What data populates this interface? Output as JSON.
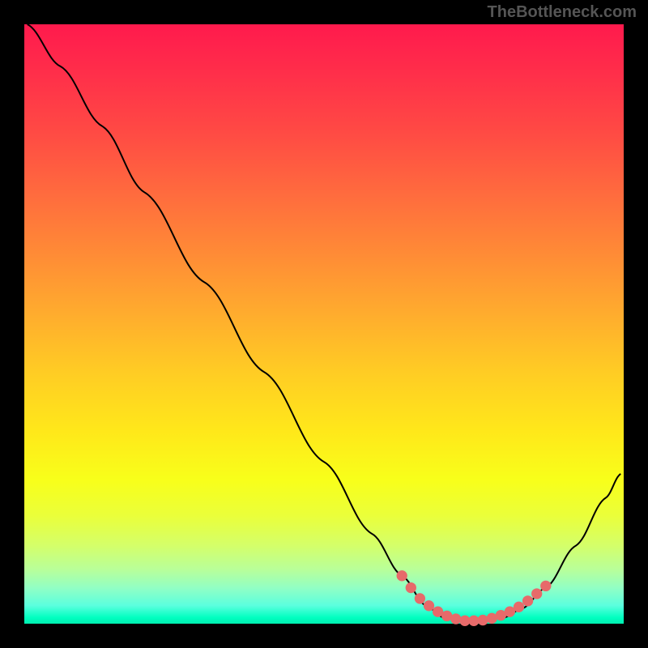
{
  "watermark": "TheBottleneck.com",
  "chart_data": {
    "type": "line",
    "title": "",
    "xlabel": "",
    "ylabel": "",
    "xlim": [
      0,
      100
    ],
    "ylim": [
      0,
      100
    ],
    "grid": false,
    "legend": false,
    "series": [
      {
        "name": "curve",
        "color": "#000000",
        "points": [
          {
            "x": 0.5,
            "y": 100
          },
          {
            "x": 6,
            "y": 93
          },
          {
            "x": 13,
            "y": 83
          },
          {
            "x": 20,
            "y": 72
          },
          {
            "x": 30,
            "y": 57
          },
          {
            "x": 40,
            "y": 42
          },
          {
            "x": 50,
            "y": 27
          },
          {
            "x": 58,
            "y": 15
          },
          {
            "x": 63,
            "y": 8
          },
          {
            "x": 67,
            "y": 3
          },
          {
            "x": 70,
            "y": 1
          },
          {
            "x": 75,
            "y": 0.5
          },
          {
            "x": 80,
            "y": 1
          },
          {
            "x": 83,
            "y": 2.5
          },
          {
            "x": 87,
            "y": 6
          },
          {
            "x": 92,
            "y": 13
          },
          {
            "x": 97,
            "y": 21
          },
          {
            "x": 99.5,
            "y": 25
          }
        ]
      },
      {
        "name": "highlight-dots",
        "color": "#e76a6a",
        "points": [
          {
            "x": 63,
            "y": 8
          },
          {
            "x": 64.5,
            "y": 6
          },
          {
            "x": 66,
            "y": 4.2
          },
          {
            "x": 67.5,
            "y": 3
          },
          {
            "x": 69,
            "y": 2
          },
          {
            "x": 70.5,
            "y": 1.3
          },
          {
            "x": 72,
            "y": 0.8
          },
          {
            "x": 73.5,
            "y": 0.5
          },
          {
            "x": 75,
            "y": 0.5
          },
          {
            "x": 76.5,
            "y": 0.6
          },
          {
            "x": 78,
            "y": 0.9
          },
          {
            "x": 79.5,
            "y": 1.4
          },
          {
            "x": 81,
            "y": 2
          },
          {
            "x": 82.5,
            "y": 2.8
          },
          {
            "x": 84,
            "y": 3.8
          },
          {
            "x": 85.5,
            "y": 5
          },
          {
            "x": 87,
            "y": 6.3
          }
        ]
      }
    ],
    "background_gradient_stops": [
      {
        "pos": 0,
        "color": "#ff1a4d"
      },
      {
        "pos": 50,
        "color": "#ffc524"
      },
      {
        "pos": 80,
        "color": "#f0ff30"
      },
      {
        "pos": 100,
        "color": "#00eeb0"
      }
    ]
  }
}
